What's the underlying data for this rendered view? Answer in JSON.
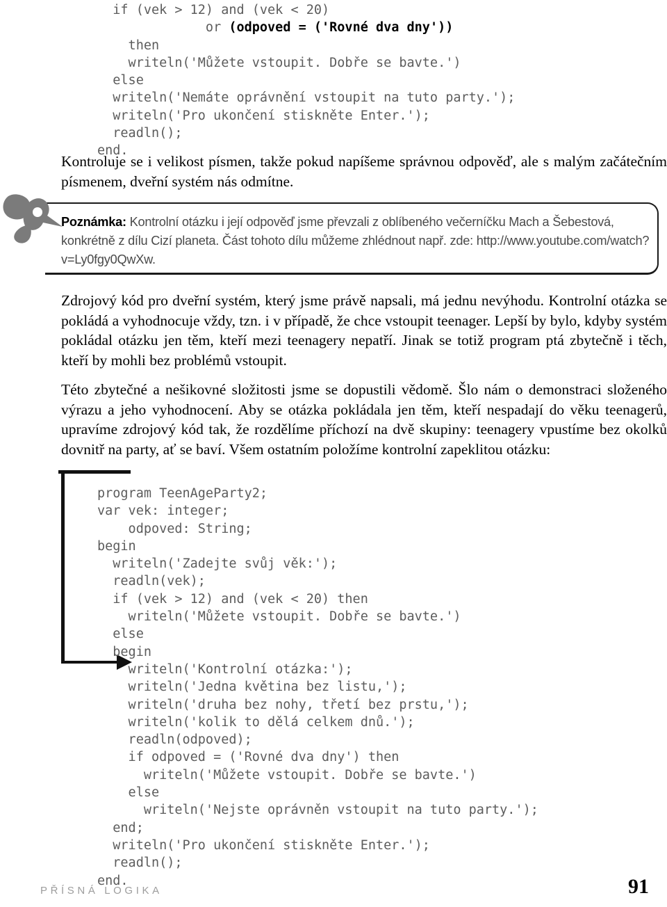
{
  "code_top": {
    "lines": [
      {
        "text": "  if (vek > 12) and (vek < 20)"
      },
      {
        "text": "              or ",
        "bold": "(odpoved = ('Rovné dva dny'))"
      },
      {
        "text": "    then"
      },
      {
        "text": "    writeln('Můžete vstoupit. Dobře se bavte.')"
      },
      {
        "text": "  else"
      },
      {
        "text": "  writeln('Nemáte oprávnění vstoupit na tuto party.');"
      },
      {
        "text": "  writeln('Pro ukončení stiskněte Enter.');"
      },
      {
        "text": "  readln();"
      },
      {
        "text": "end."
      }
    ]
  },
  "paragraph_1": "Kontroluje se i velikost písmen, takže pokud napíšeme správnou odpověď, ale s malým začátečním písmenem, dveřní systém nás odmítne.",
  "note": {
    "lead": "Poznámka:",
    "body": " Kontrolní otázku i její odpověď jsme převzali z oblíbeného večerníčku Mach a Šebestová, konkrétně z dílu Cizí planeta. Část tohoto dílu můžeme zhlédnout např. zde: http://www.youtube.com/watch?v=Ly0fgy0QwXw."
  },
  "paragraph_2": "Zdrojový kód pro dveřní systém, který jsme právě napsali, má jednu nevýhodu. Kontrolní otázka se pokládá a vyhodnocuje vždy, tzn. i v případě, že chce vstoupit teenager. Lepší by bylo, kdyby systém pokládal otázku jen těm, kteří mezi teenagery nepatří. Jinak se totiž program ptá zbytečně i těch, kteří by mohli bez problémů vstoupit.",
  "paragraph_3": "Této zbytečné a nešikovné složitosti jsme se dopustili vědomě. Šlo nám o demonstraci složeného výrazu a jeho vyhodnocení. Aby se otázka pokládala jen těm, kteří nespadají do věku teenagerů, upravíme zdrojový kód tak, že rozdělíme příchozí na dvě skupiny: teenagery vpustíme bez okolků dovnitř na party, ať se baví. Všem ostatním položíme kontrolní zapeklitou otázku:",
  "code_bottom": {
    "lines": [
      {
        "text": "program TeenAgeParty2;"
      },
      {
        "text": "var vek: integer;"
      },
      {
        "text": "    odpoved: String;"
      },
      {
        "text": "begin"
      },
      {
        "text": "  writeln('Zadejte svůj věk:');"
      },
      {
        "text": "  readln(vek);"
      },
      {
        "text": "  if (vek > 12) and (vek < 20) then"
      },
      {
        "text": "    writeln('Můžete vstoupit. Dobře se bavte.')"
      },
      {
        "text": "  else"
      },
      {
        "text": "  begin"
      },
      {
        "text": "    writeln('Kontrolní otázka:');"
      },
      {
        "text": "    writeln('Jedna květina bez listu,');"
      },
      {
        "text": "    writeln('druha bez nohy, třetí bez prstu,');"
      },
      {
        "text": "    writeln('kolik to dělá celkem dnů.');"
      },
      {
        "text": "    readln(odpoved);"
      },
      {
        "text": "    if odpoved = ('Rovné dva dny') then"
      },
      {
        "text": "      writeln('Můžete vstoupit. Dobře se bavte.')"
      },
      {
        "text": "    else"
      },
      {
        "text": "      writeln('Nejste oprávněn vstoupit na tuto party.');"
      },
      {
        "text": "  end;"
      },
      {
        "text": "  writeln('Pro ukončení stiskněte Enter.');"
      },
      {
        "text": "  readln();"
      },
      {
        "text": "end."
      }
    ]
  },
  "footer": {
    "running_title": "PŘÍSNÁ LOGIKA",
    "page_number": "91"
  },
  "icons": {
    "note": "quill-nib-icon",
    "marker": "callout-arrow-icon"
  },
  "colors": {
    "code_text": "#5c5c5c",
    "note_text": "#4a4a4a",
    "footer_title": "#9d9d9d",
    "rule": "#1a1a1a"
  }
}
